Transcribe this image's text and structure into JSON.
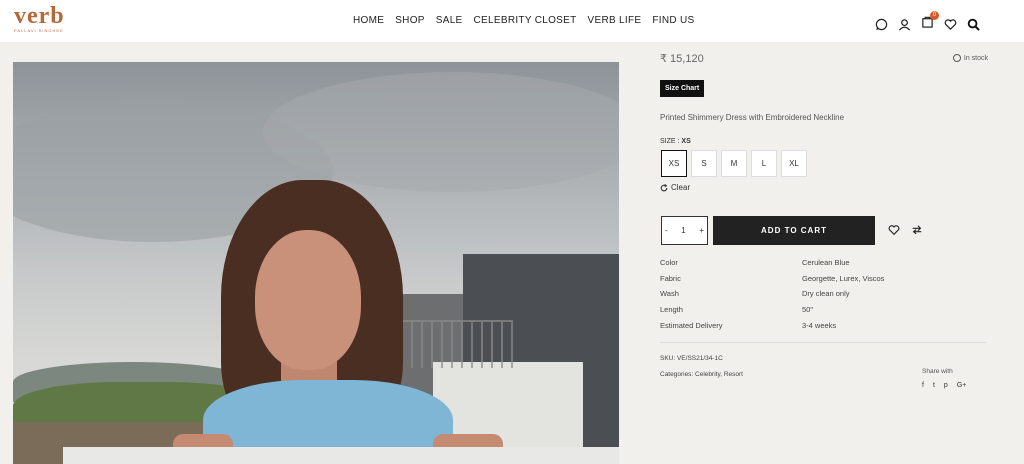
{
  "brand": {
    "name": "verb",
    "tagline": "PALLAVI SINGHEE",
    "color": "#b5693a"
  },
  "nav": {
    "items": [
      "HOME",
      "SHOP",
      "SALE",
      "CELEBRITY CLOSET",
      "VERB LIFE",
      "FIND US"
    ]
  },
  "header_icons": {
    "whatsapp": "whatsapp-icon",
    "account": "user-icon",
    "cart": "cart-icon",
    "cart_count": "0",
    "wishlist": "heart-icon",
    "search": "search-icon"
  },
  "product": {
    "price": "₹ 15,120",
    "stock": "In stock",
    "size_chart_label": "Size Chart",
    "description": "Printed Shimmery Dress with Embroidered Neckline",
    "size_label": "SIZE :",
    "size_selected": "XS",
    "sizes": [
      "XS",
      "S",
      "M",
      "L",
      "XL"
    ],
    "clear_label": "Clear",
    "qty": {
      "minus": "-",
      "value": "1",
      "plus": "+"
    },
    "add_to_cart": "ADD TO CART",
    "attributes": [
      {
        "key": "Color",
        "value": "Cerulean Blue"
      },
      {
        "key": "Fabric",
        "value": "Georgette, Lurex, Viscos"
      },
      {
        "key": "Wash",
        "value": "Dry clean only"
      },
      {
        "key": "Length",
        "value": "50\""
      },
      {
        "key": "Estimated Delivery",
        "value": "3-4 weeks"
      }
    ],
    "sku": "SKU: VE/SS21/34-1C",
    "categories": "Categories: Celebrity, Resort",
    "share_label": "Share with",
    "social": [
      "f",
      "t",
      "p",
      "G+"
    ]
  },
  "colors": {
    "accent": "#d85a2b",
    "button_dark": "#222222",
    "background": "#f1f0ec"
  }
}
